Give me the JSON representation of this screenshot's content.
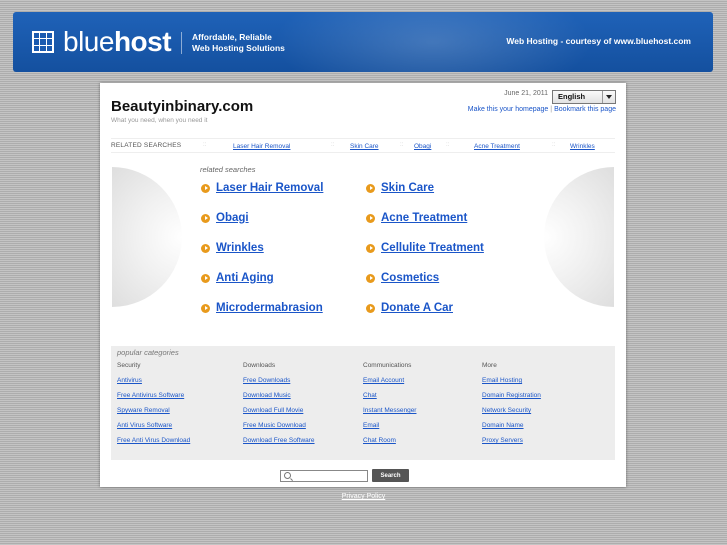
{
  "header": {
    "logo_light": "blue",
    "logo_bold": "host",
    "tagline_line1": "Affordable, Reliable",
    "tagline_line2": "Web Hosting Solutions",
    "courtesy": "Web Hosting - courtesy of www.bluehost.com"
  },
  "site": {
    "title": "Beautyinbinary.com",
    "subtitle": "What you need, when you need it",
    "date": "June 21, 2011",
    "language": "English",
    "make_homepage": "Make this your homepage",
    "bookmark": "Bookmark this page"
  },
  "related_bar": {
    "label": "RELATED SEARCHES",
    "links": [
      "Laser Hair Removal",
      "Skin Care",
      "Obagi",
      "Acne Treatment",
      "Wrinkles"
    ]
  },
  "related": {
    "heading": "related searches",
    "left": [
      "Laser Hair Removal",
      "Obagi",
      "Wrinkles",
      "Anti Aging",
      "Microdermabrasion"
    ],
    "right": [
      "Skin Care",
      "Acne Treatment",
      "Cellulite Treatment",
      "Cosmetics",
      "Donate A Car"
    ]
  },
  "popular": {
    "heading": "popular categories",
    "columns": [
      {
        "title": "Security",
        "links": [
          "Antivirus",
          "Free Antivirus Software",
          "Spyware Removal",
          "Anti Virus Software",
          "Free Anti Virus Download"
        ]
      },
      {
        "title": "Downloads",
        "links": [
          "Free Downloads",
          "Download Music",
          "Download Full Movie",
          "Free Music Download",
          "Download Free Software"
        ]
      },
      {
        "title": "Communications",
        "links": [
          "Email Account",
          "Chat",
          "Instant Messenger",
          "Email",
          "Chat Room"
        ]
      },
      {
        "title": "More",
        "links": [
          "Email Hosting",
          "Domain Registration",
          "Network Security",
          "Domain Name",
          "Proxy Servers"
        ]
      }
    ]
  },
  "search": {
    "button": "Search"
  },
  "footer": {
    "privacy": "Privacy Policy"
  },
  "colors": {
    "brand_blue": "#1a5ab0",
    "link_blue": "#1a55c8",
    "bullet_orange": "#e89a1c"
  },
  "icons": [
    "bluehost-logo-icon",
    "chevron-down-icon",
    "arrow-right-icon",
    "search-icon"
  ]
}
